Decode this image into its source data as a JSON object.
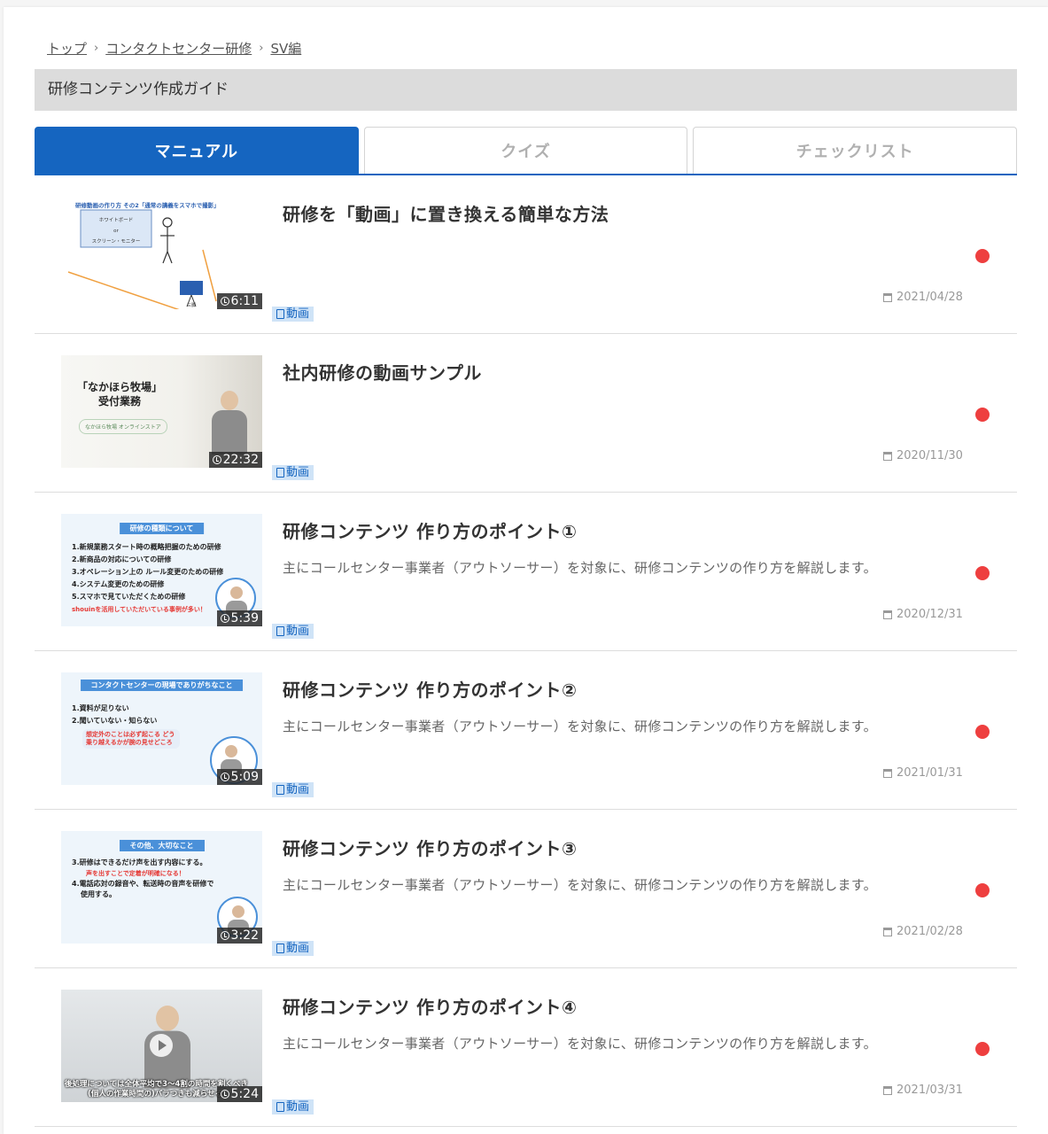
{
  "breadcrumb": {
    "items": [
      "トップ",
      "コンタクトセンター研修",
      "SV編"
    ],
    "separator": "›"
  },
  "page_title": "研修コンテンツ作成ガイド",
  "tabs": [
    {
      "label": "マニュアル",
      "active": true
    },
    {
      "label": "クイズ",
      "active": false
    },
    {
      "label": "チェックリスト",
      "active": false
    }
  ],
  "tag_label": "動画",
  "colors": {
    "accent": "#1565c0",
    "unread_dot": "#ee3f3f",
    "tag_bg": "#cfe3f7"
  },
  "items": [
    {
      "title": "研修を「動画」に置き換える簡単な方法",
      "description": "",
      "duration": "6:11",
      "date": "2021/04/28",
      "thumb": {
        "heading": "研修動画の作り方 その2「通常の講義をスマホで撮影」",
        "board_line1": "ホワイトボード",
        "board_line2": "or",
        "board_line3": "スクリーン・モニター",
        "camera_label": "三脚"
      }
    },
    {
      "title": "社内研修の動画サンプル",
      "description": "",
      "duration": "22:32",
      "date": "2020/11/30",
      "thumb": {
        "line1": "「なかほら牧場」",
        "line2": "受付業務",
        "sub": "なかほら牧場 オンラインストア"
      }
    },
    {
      "title": "研修コンテンツ 作り方のポイント①",
      "description": "主にコールセンター事業者（アウトソーサー）を対象に、研修コンテンツの作り方を解説します。",
      "duration": "5:39",
      "date": "2020/12/31",
      "thumb": {
        "heading": "研修の種類について",
        "lines": [
          "1.新規業務スタート時の概略把握のための研修",
          "2.新商品の対応についての研修",
          "3.オペレーション上の ルール変更のための研修",
          "4.システム変更のための研修",
          "5.スマホで見ていただくための研修"
        ],
        "red": "shouinを活用していただいている事例が多い！"
      }
    },
    {
      "title": "研修コンテンツ 作り方のポイント②",
      "description": "主にコールセンター事業者（アウトソーサー）を対象に、研修コンテンツの作り方を解説します。",
      "duration": "5:09",
      "date": "2021/01/31",
      "thumb": {
        "heading": "コンタクトセンターの現場でありがちなこと",
        "lines": [
          "1.資料が足りない",
          "2.聞いていない・知らない"
        ],
        "red": "想定外のことは必ず起こる どう乗り越えるかが腕の見せどころ"
      }
    },
    {
      "title": "研修コンテンツ 作り方のポイント③",
      "description": "主にコールセンター事業者（アウトソーサー）を対象に、研修コンテンツの作り方を解説します。",
      "duration": "3:22",
      "date": "2021/02/28",
      "thumb": {
        "heading": "その他、大切なこと",
        "lines": [
          "3.研修はできるだけ声を出す内容にする。",
          "4.電話応対の録音や、転送時の音声を研修で",
          "使用する。"
        ],
        "red": "声を出すことで定着が明確になる！"
      }
    },
    {
      "title": "研修コンテンツ 作り方のポイント④",
      "description": "主にコールセンター事業者（アウトソーサー）を対象に、研修コンテンツの作り方を解説します。",
      "duration": "5:24",
      "date": "2021/03/31",
      "thumb": {
        "caption1": "後処理については全体平均で3〜4割の時間を割くべき",
        "caption2": "(個人の作業時間の)バラつきも減らせる"
      }
    }
  ]
}
